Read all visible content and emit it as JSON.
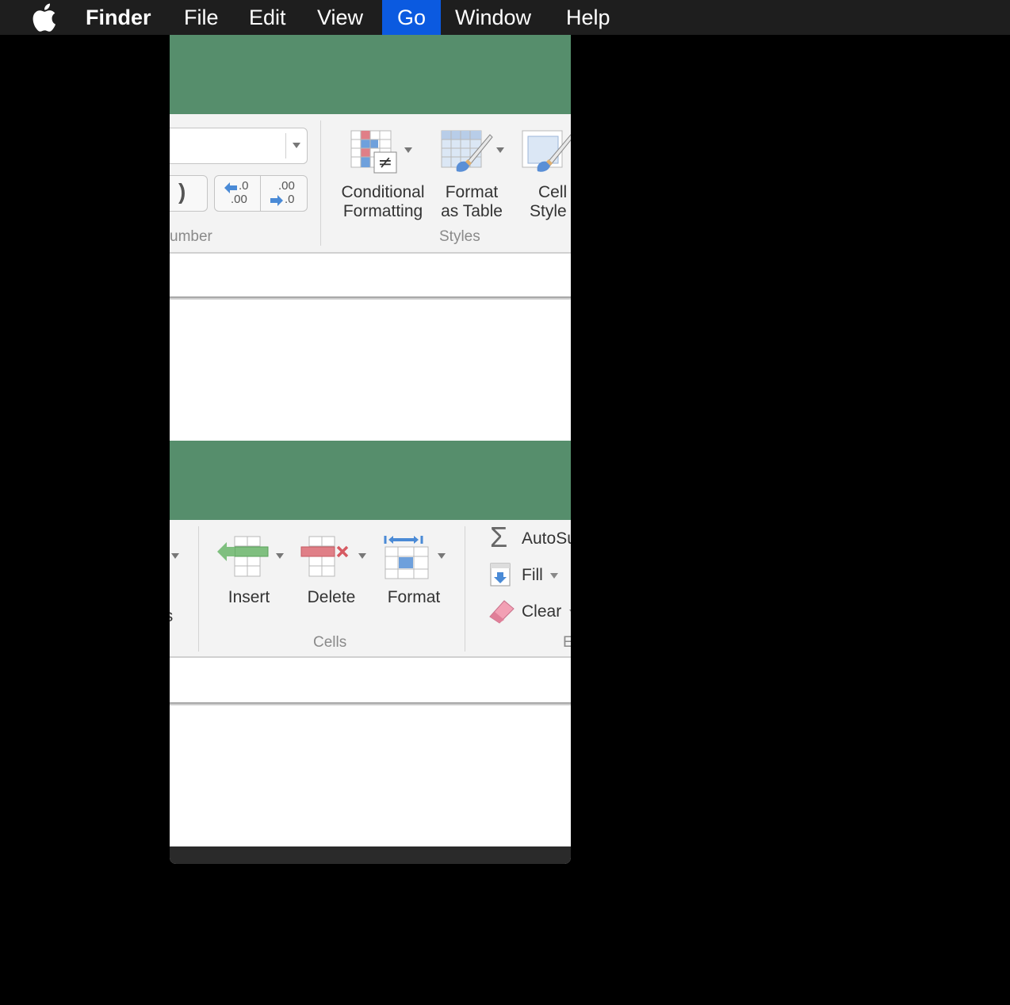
{
  "menubar": {
    "app_name": "Finder",
    "items": [
      "File",
      "Edit",
      "View",
      "Go",
      "Window",
      "Help"
    ],
    "active_item": "Go"
  },
  "top_panel": {
    "number_group_label": "umber",
    "decimal_increase": {
      "top": ".0",
      "bottom": ".00"
    },
    "decimal_decrease": {
      "top": ".00",
      "bottom": ".0"
    },
    "paren_glyph": ")",
    "conditional_formatting": {
      "line1": "Conditional",
      "line2": "Formatting"
    },
    "format_as_table": {
      "line1": "Format",
      "line2": "as Table"
    },
    "cell_styles": {
      "line1": "Cell",
      "line2": "Style"
    },
    "styles_group_label": "Styles",
    "not_equal_glyph": "≠"
  },
  "bottom_panel": {
    "partial_text": "s",
    "insert_label": "Insert",
    "delete_label": "Delete",
    "format_label": "Format",
    "cells_group_label": "Cells",
    "autosum_label": "AutoSu",
    "fill_label": "Fill",
    "clear_label": "Clear",
    "editing_group_label": "E",
    "sigma_glyph": "Σ"
  },
  "colors": {
    "ribbon_green": "#568e6c",
    "menu_highlight": "#0b5ae0"
  }
}
